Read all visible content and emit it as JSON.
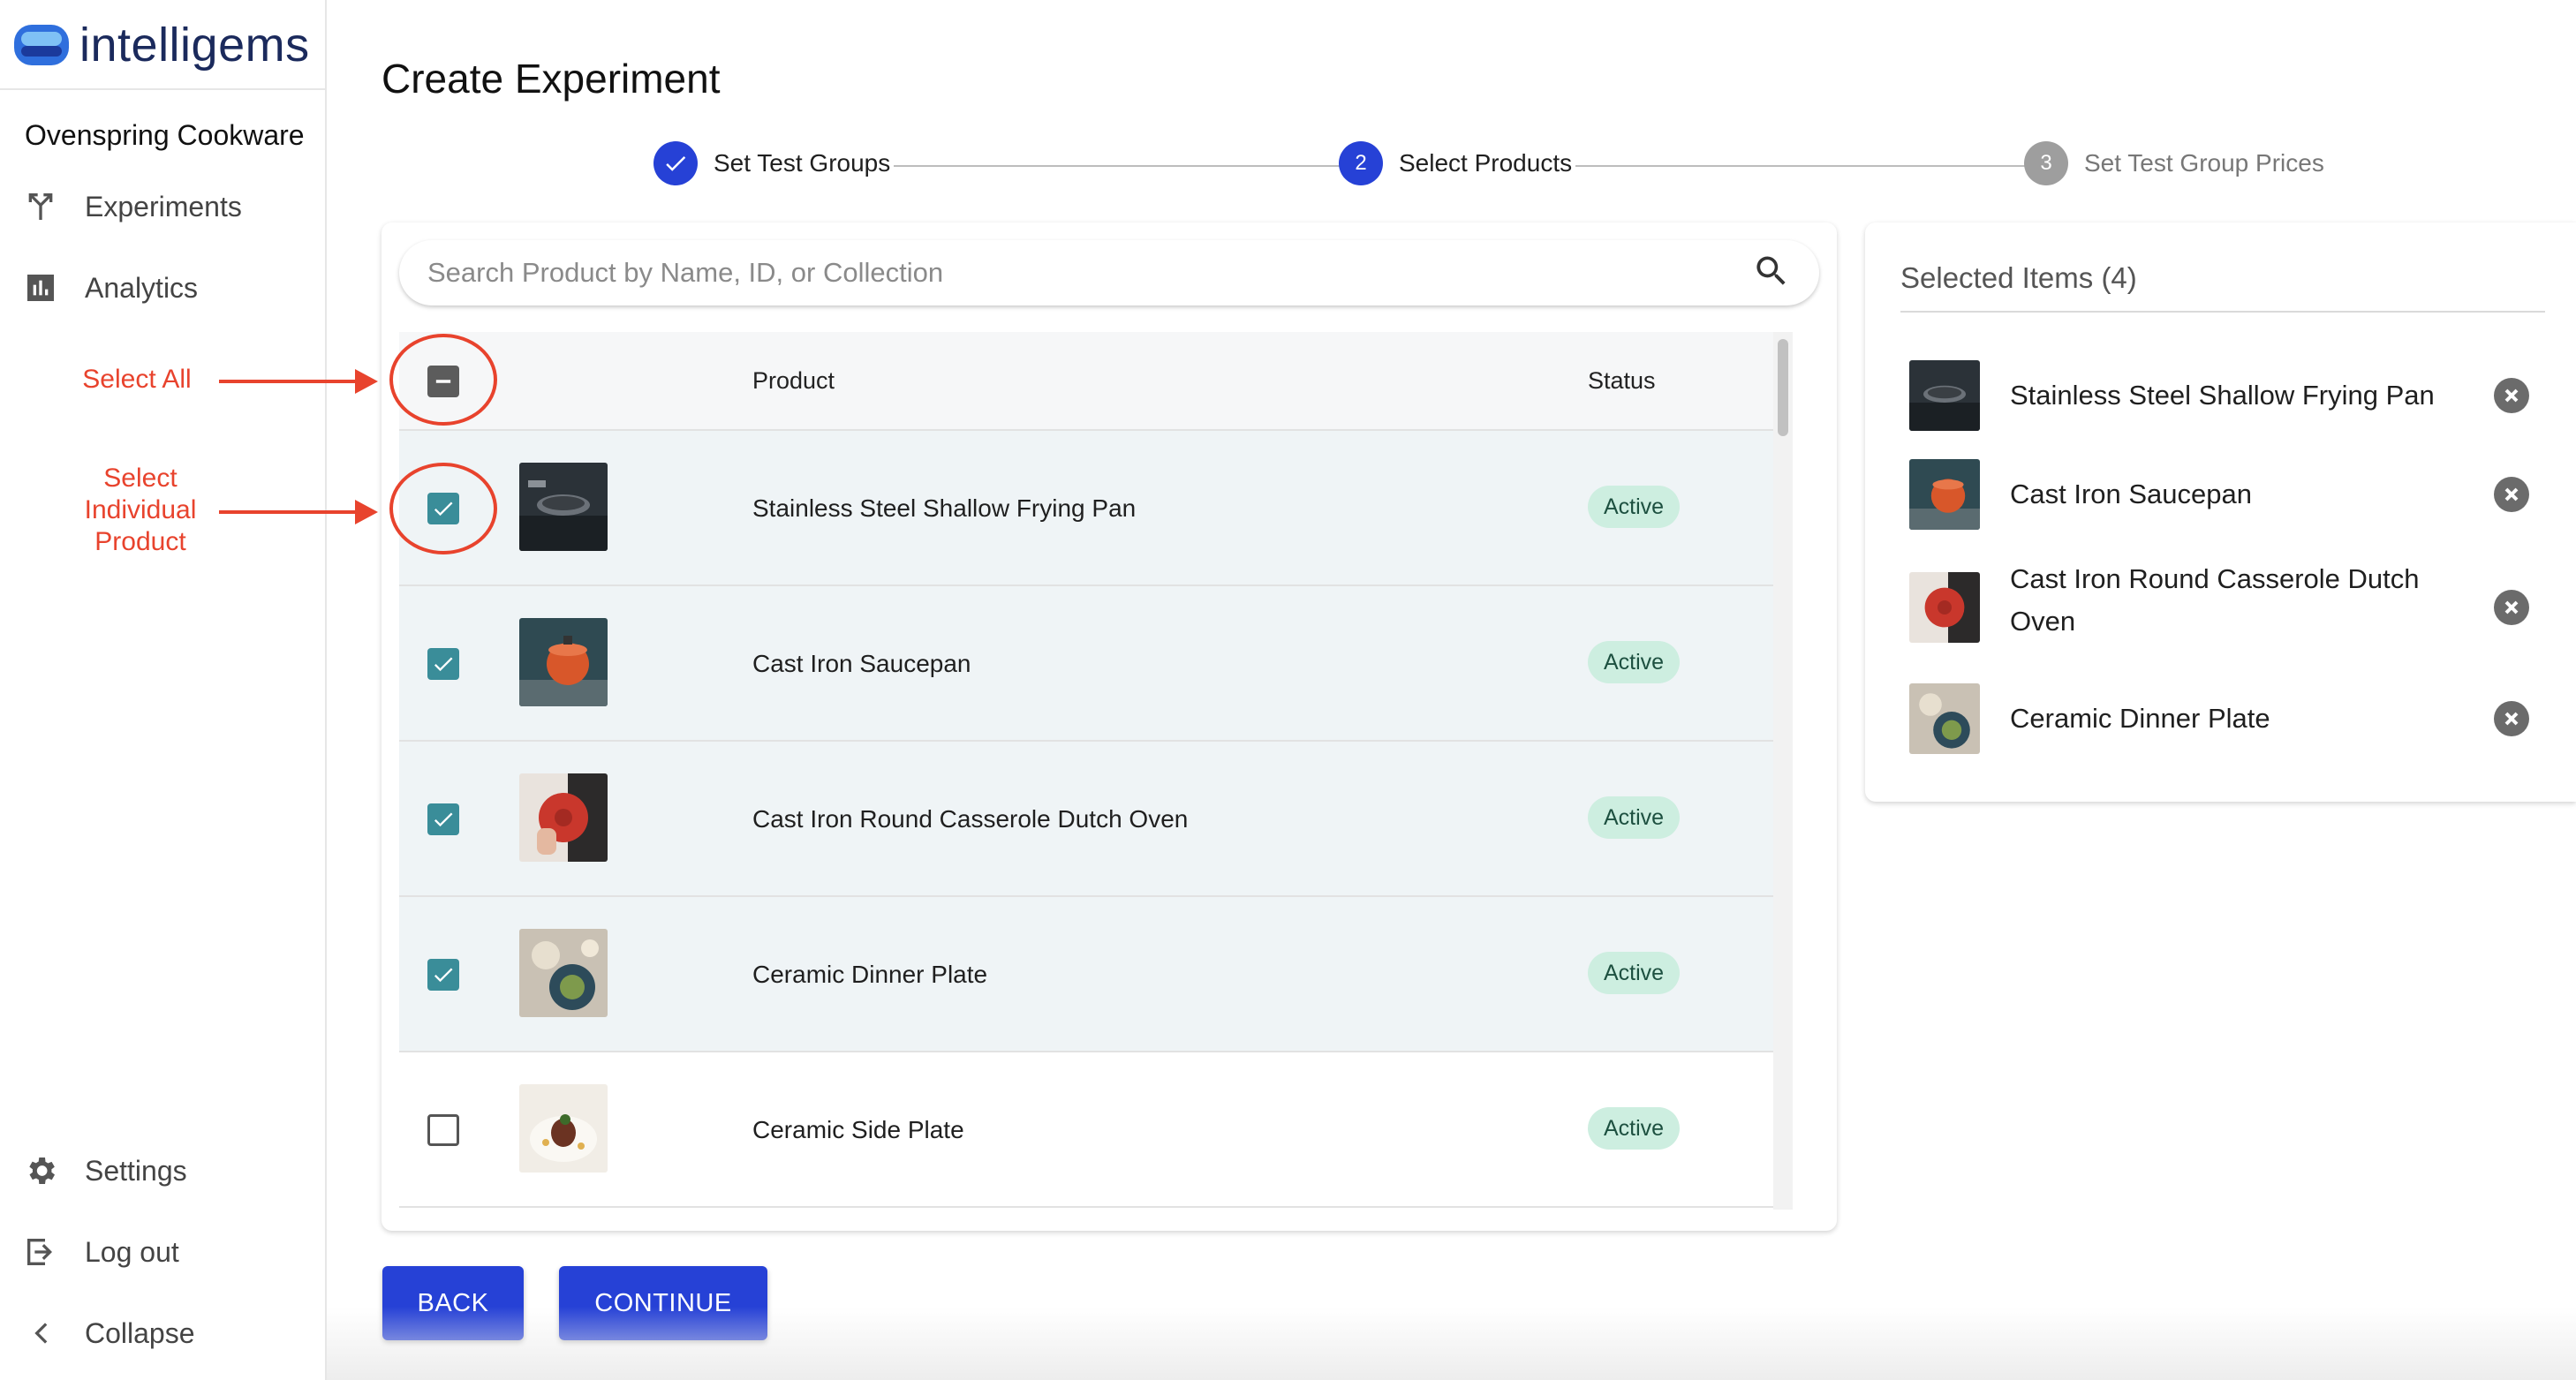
{
  "app": {
    "brand": "intelligems",
    "store_name": "Ovenspring Cookware"
  },
  "sidebar": {
    "top_items": [
      {
        "label": "Experiments",
        "icon": "experiments-fork-icon"
      },
      {
        "label": "Analytics",
        "icon": "bar-chart-icon"
      }
    ],
    "bottom_items": [
      {
        "label": "Settings",
        "icon": "gear-icon"
      },
      {
        "label": "Log out",
        "icon": "logout-icon"
      },
      {
        "label": "Collapse",
        "icon": "chevron-left-icon"
      }
    ]
  },
  "annotations": {
    "select_all": "Select All",
    "select_individual": "Select Individual Product",
    "color": "#e8432d"
  },
  "page_title": "Create Experiment",
  "stepper": {
    "steps": [
      {
        "label": "Set Test Groups",
        "state": "complete",
        "number": ""
      },
      {
        "label": "Select Products",
        "state": "active",
        "number": "2"
      },
      {
        "label": "Set Test Group Prices",
        "state": "inactive",
        "number": "3"
      }
    ]
  },
  "search": {
    "placeholder": "Search Product by Name, ID, or Collection",
    "value": ""
  },
  "table": {
    "headers": {
      "product": "Product",
      "status": "Status"
    },
    "select_all_state": "indeterminate",
    "rows": [
      {
        "name": "Stainless Steel Shallow Frying Pan",
        "status": "Active",
        "checked": true
      },
      {
        "name": "Cast Iron Saucepan",
        "status": "Active",
        "checked": true
      },
      {
        "name": "Cast Iron Round Casserole Dutch Oven",
        "status": "Active",
        "checked": true
      },
      {
        "name": "Ceramic Dinner Plate",
        "status": "Active",
        "checked": true
      },
      {
        "name": "Ceramic Side Plate",
        "status": "Active",
        "checked": false
      }
    ]
  },
  "selected": {
    "title": "Selected Items (4)",
    "items": [
      {
        "name": "Stainless Steel Shallow Frying Pan"
      },
      {
        "name": "Cast Iron Saucepan"
      },
      {
        "name": "Cast Iron Round Casserole Dutch Oven"
      },
      {
        "name": "Ceramic Dinner Plate"
      }
    ]
  },
  "buttons": {
    "back": "BACK",
    "continue": "CONTINUE"
  },
  "colors": {
    "accent": "#2641d6",
    "checkbox": "#3a8d99",
    "badge_bg": "#cdeee0",
    "selected_row": "#eff4f6"
  }
}
